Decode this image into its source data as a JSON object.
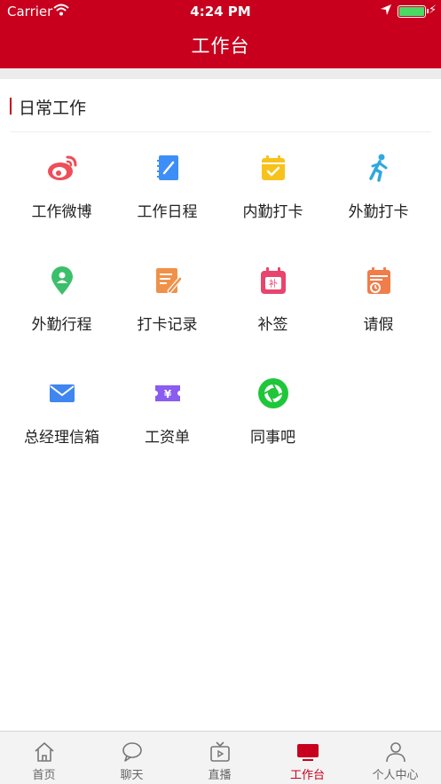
{
  "status_bar": {
    "carrier": "Carrier",
    "time": "4:24 PM"
  },
  "nav": {
    "title": "工作台"
  },
  "section": {
    "title": "日常工作"
  },
  "tiles": [
    {
      "label": "工作微博",
      "icon": "weibo-icon"
    },
    {
      "label": "工作日程",
      "icon": "notebook-icon"
    },
    {
      "label": "内勤打卡",
      "icon": "calendar-check-icon"
    },
    {
      "label": "外勤打卡",
      "icon": "runner-icon"
    },
    {
      "label": "外勤行程",
      "icon": "location-pin-icon"
    },
    {
      "label": "打卡记录",
      "icon": "note-edit-icon"
    },
    {
      "label": "补签",
      "icon": "calendar-supplement-icon"
    },
    {
      "label": "请假",
      "icon": "calendar-clock-icon"
    },
    {
      "label": "总经理信箱",
      "icon": "mail-icon"
    },
    {
      "label": "工资单",
      "icon": "ticket-yen-icon"
    },
    {
      "label": "同事吧",
      "icon": "aperture-icon"
    }
  ],
  "tabs": [
    {
      "label": "首页",
      "icon": "home-icon"
    },
    {
      "label": "聊天",
      "icon": "chat-icon"
    },
    {
      "label": "直播",
      "icon": "tv-icon"
    },
    {
      "label": "工作台",
      "icon": "workbench-icon",
      "active": true
    },
    {
      "label": "个人中心",
      "icon": "person-icon"
    }
  ],
  "colors": {
    "brand": "#c8001e",
    "active_tab": "#c8001e",
    "battery": "#4cd964"
  }
}
